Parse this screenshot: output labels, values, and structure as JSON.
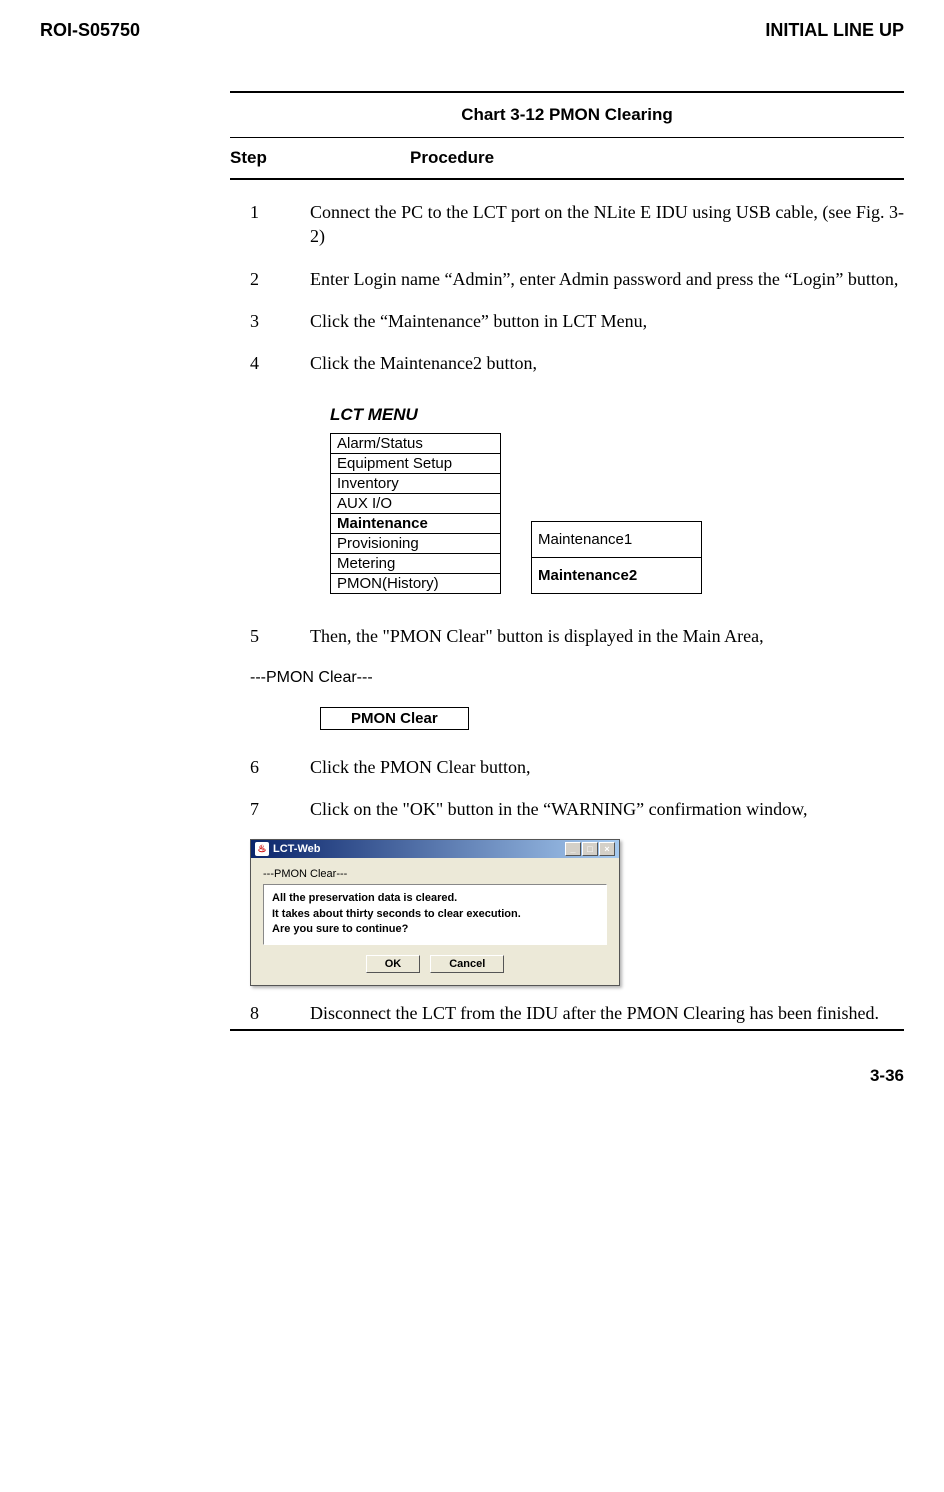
{
  "header": {
    "left": "ROI-S05750",
    "right": "INITIAL LINE UP"
  },
  "chart_title": "Chart 3-12 PMON Clearing",
  "step_header": {
    "step": "Step",
    "procedure": "Procedure"
  },
  "steps": [
    {
      "num": "1",
      "text": "Connect the PC to the LCT port on the NLite E IDU using USB cable, (see Fig. 3-2)"
    },
    {
      "num": "2",
      "text": "Enter Login name “Admin”, enter Admin password and press the “Login” button,"
    },
    {
      "num": "3",
      "text": "Click the “Maintenance” button in LCT Menu,"
    },
    {
      "num": "4",
      "text": "Click the Maintenance2 button,"
    },
    {
      "num": "5",
      "text": "Then, the \"PMON Clear\" button is displayed in the Main Area,"
    },
    {
      "num": "6",
      "text": "Click the PMON Clear button,"
    },
    {
      "num": "7",
      "text": "Click on the \"OK\" button in the “WARNING” confirmation window,"
    },
    {
      "num": "8",
      "text": "Disconnect the LCT from the IDU after the PMON Clearing has been finished."
    }
  ],
  "lct_menu": {
    "title": "LCT MENU",
    "items": [
      {
        "label": "Alarm/Status",
        "bold": false
      },
      {
        "label": "Equipment Setup",
        "bold": false
      },
      {
        "label": "Inventory",
        "bold": false
      },
      {
        "label": "AUX I/O",
        "bold": false
      },
      {
        "label": "Maintenance",
        "bold": true
      },
      {
        "label": "Provisioning",
        "bold": false
      },
      {
        "label": "Metering",
        "bold": false
      },
      {
        "label": "PMON(History)",
        "bold": false
      }
    ],
    "submenu": [
      {
        "label": "Maintenance1",
        "bold": false
      },
      {
        "label": "Maintenance2",
        "bold": true
      }
    ]
  },
  "pmon_clear": {
    "section_label": "---PMON Clear---",
    "button_label": "PMON Clear"
  },
  "dialog": {
    "title": "LCT-Web",
    "section_label": "---PMON Clear---",
    "msg_line1": "All the preservation data is cleared.",
    "msg_line2": "It takes about thirty seconds to clear execution.",
    "msg_line3": "Are you sure to continue?",
    "ok_label": "OK",
    "cancel_label": "Cancel"
  },
  "page_number": "3-36"
}
